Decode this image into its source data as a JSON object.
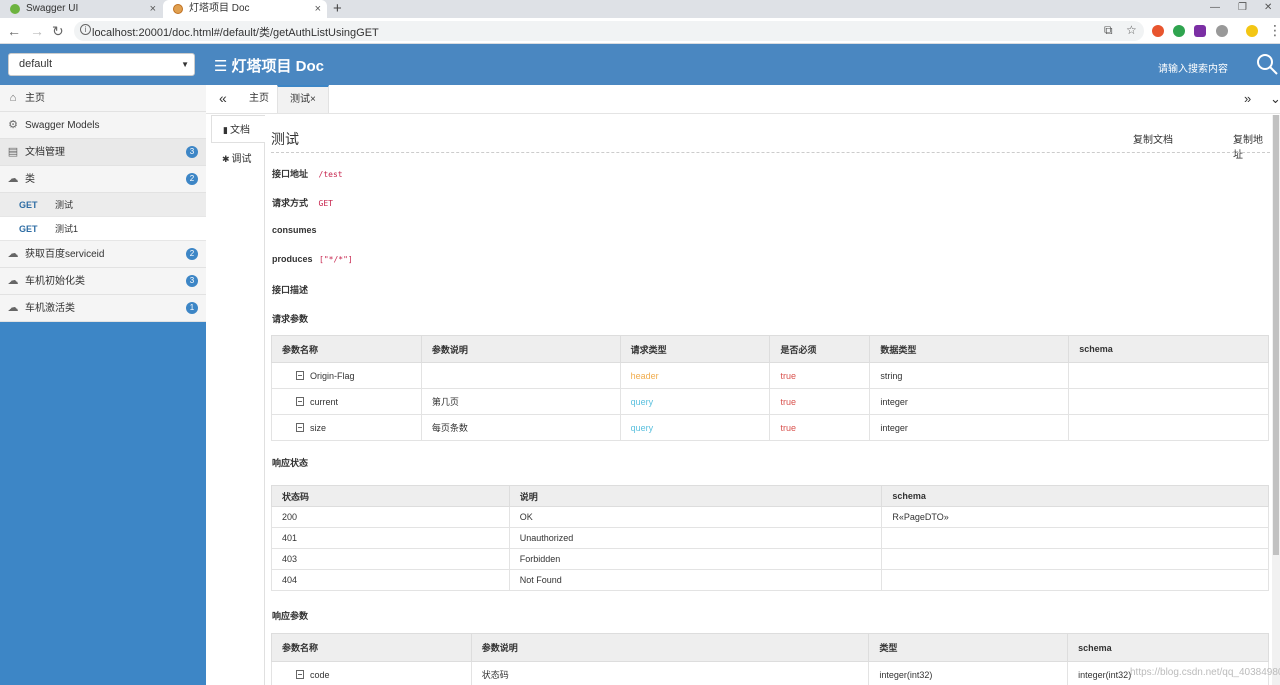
{
  "browser": {
    "tabs": [
      {
        "title": "Swagger UI",
        "close": "×"
      },
      {
        "title": "灯塔项目 Doc",
        "close": "×"
      }
    ],
    "new_tab": "+",
    "url": "localhost:20001/doc.html#/default/类/getAuthListUsingGET",
    "window_controls": [
      "—",
      "❐",
      "✕"
    ]
  },
  "header": {
    "group_select": "default",
    "title": "灯塔项目 Doc",
    "menu_glyph": "☰",
    "search_placeholder": "请输入搜索内容"
  },
  "sidebar": {
    "home": "主页",
    "models": "Swagger Models",
    "doc_mgmt": {
      "label": "文档管理",
      "count": "3"
    },
    "cls": {
      "label": "类",
      "count": "2"
    },
    "cls_ops": [
      {
        "method": "GET",
        "name": "测试"
      },
      {
        "method": "GET",
        "name": "测试1"
      }
    ],
    "baidu": {
      "label": "获取百度serviceid",
      "count": "2"
    },
    "car_init": {
      "label": "车机初始化类",
      "count": "3"
    },
    "car_activate": {
      "label": "车机激活类",
      "count": "1"
    }
  },
  "tabbar": {
    "collapse": "«",
    "home": "主页",
    "active": "测试×",
    "next": "»",
    "more": "⌄"
  },
  "doc_tabs": {
    "doc": "文档",
    "debug": "调试"
  },
  "operation": {
    "title": "测试",
    "copy_doc": "复制文档",
    "copy_addr": "复制地址",
    "addr_label": "接口地址",
    "addr_value": "/test",
    "method_label": "请求方式",
    "method_value": "GET",
    "consumes_label": "consumes",
    "produces_label": "produces",
    "produces_value": "[\"*/*\"]",
    "desc_label": "接口描述",
    "req_params_label": "请求参数",
    "resp_status_label": "响应状态",
    "resp_params_label": "响应参数"
  },
  "req_params": {
    "headers": [
      "参数名称",
      "参数说明",
      "请求类型",
      "是否必须",
      "数据类型",
      "schema"
    ],
    "rows": [
      {
        "name": "Origin-Flag",
        "desc": "",
        "in": "header",
        "required": "true",
        "type": "string",
        "schema": ""
      },
      {
        "name": "current",
        "desc": "第几页",
        "in": "query",
        "required": "true",
        "type": "integer",
        "schema": ""
      },
      {
        "name": "size",
        "desc": "每页条数",
        "in": "query",
        "required": "true",
        "type": "integer",
        "schema": ""
      }
    ]
  },
  "resp_status": {
    "headers": [
      "状态码",
      "说明",
      "schema"
    ],
    "rows": [
      {
        "code": "200",
        "desc": "OK",
        "schema": "R«PageDTO»"
      },
      {
        "code": "401",
        "desc": "Unauthorized",
        "schema": ""
      },
      {
        "code": "403",
        "desc": "Forbidden",
        "schema": ""
      },
      {
        "code": "404",
        "desc": "Not Found",
        "schema": ""
      }
    ]
  },
  "resp_params": {
    "headers": [
      "参数名称",
      "参数说明",
      "类型",
      "schema"
    ],
    "rows": [
      {
        "name": "code",
        "desc": "状态码",
        "type": "integer(int32)",
        "schema": "integer(int32)"
      }
    ]
  },
  "watermark": "https://blog.csdn.net/qq_40384980",
  "colors": {
    "brand": "#4a87c1",
    "sidebar": "#3d86c6",
    "method_get": "#2e6da4",
    "header_in": "#f0ad4e",
    "query_in": "#5bc0de",
    "required": "#d9534f"
  }
}
